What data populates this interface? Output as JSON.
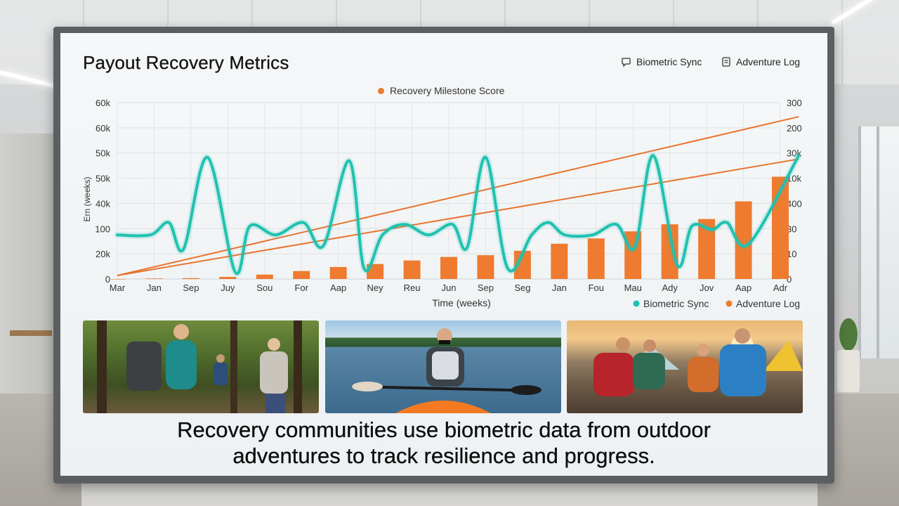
{
  "dashboard": {
    "title": "Payout Recovery Metrics",
    "buttons": {
      "sync_label": "Biometric Sync",
      "log_label": "Adventure Log"
    },
    "caption_line1": "Recovery communities use biometric data from outdoor",
    "caption_line2": "adventures to track resilience and progress."
  },
  "photos": [
    {
      "name": "hikers-on-forest-trail",
      "icon": "photo"
    },
    {
      "name": "kayaker-on-lake",
      "icon": "photo"
    },
    {
      "name": "campers-checking-wearables",
      "icon": "photo"
    }
  ],
  "chart_data": {
    "type": "line",
    "legend_top": "Recovery Milestone Score",
    "legend_bottom": [
      "Biometric Sync",
      "Adventure Log"
    ],
    "xlabel": "Time (weeks)",
    "ylabel": "Ern (weeks)",
    "categories": [
      "Mar",
      "Jan",
      "Sep",
      "Juy",
      "Sou",
      "For",
      "Aap",
      "Ney",
      "Reu",
      "Jun",
      "Sep",
      "Seg",
      "Jan",
      "Fou",
      "Mau",
      "Ady",
      "Jov",
      "Aap",
      "Adr"
    ],
    "y_left_ticks": [
      "60k",
      "60k",
      "50k",
      "50k",
      "40k",
      "100",
      "20k",
      "0"
    ],
    "y_right_ticks": [
      "300",
      "200",
      "30k",
      "10k",
      "400",
      "30",
      "10",
      "0"
    ],
    "colors": {
      "sync": "#1fc1b0",
      "log": "#ee7b30",
      "trend": "#e8742e"
    },
    "series": [
      {
        "name": "Biometric Sync",
        "type": "line",
        "x": [
          0,
          0.9,
          1.4,
          1.8,
          2.45,
          3.2,
          3.6,
          4.3,
          5.05,
          5.6,
          6.3,
          6.7,
          7.2,
          7.8,
          8.45,
          9.1,
          9.5,
          10,
          10.6,
          11.25,
          11.7,
          12.15,
          12.9,
          13.55,
          14.05,
          14.55,
          15.2,
          15.6,
          16.15,
          16.55,
          17.15,
          18.5
        ],
        "y": [
          25,
          25,
          32,
          17,
          69,
          4,
          30,
          25,
          32,
          19,
          67,
          6,
          25,
          31,
          25,
          31,
          18,
          69,
          6,
          25,
          32,
          25,
          25,
          31,
          18,
          70,
          8,
          30,
          28,
          32,
          20,
          70
        ]
      },
      {
        "name": "Adventure Log",
        "type": "bar",
        "values": [
          0,
          0.3,
          0.5,
          1.2,
          2.5,
          4.5,
          6.8,
          8.5,
          10.5,
          12.5,
          13.5,
          16,
          20,
          23,
          27,
          31,
          34,
          44,
          58
        ]
      },
      {
        "name": "Recovery Milestone Score",
        "type": "line",
        "x": [
          0,
          18.5
        ],
        "y": [
          2,
          92
        ]
      },
      {
        "type": "line",
        "x": [
          0,
          18.5
        ],
        "y": [
          2,
          68
        ]
      }
    ],
    "ylim": [
      0,
      100
    ],
    "grid": true,
    "legend_top_position": "top-center",
    "legend_bottom_position": "bottom-right"
  }
}
